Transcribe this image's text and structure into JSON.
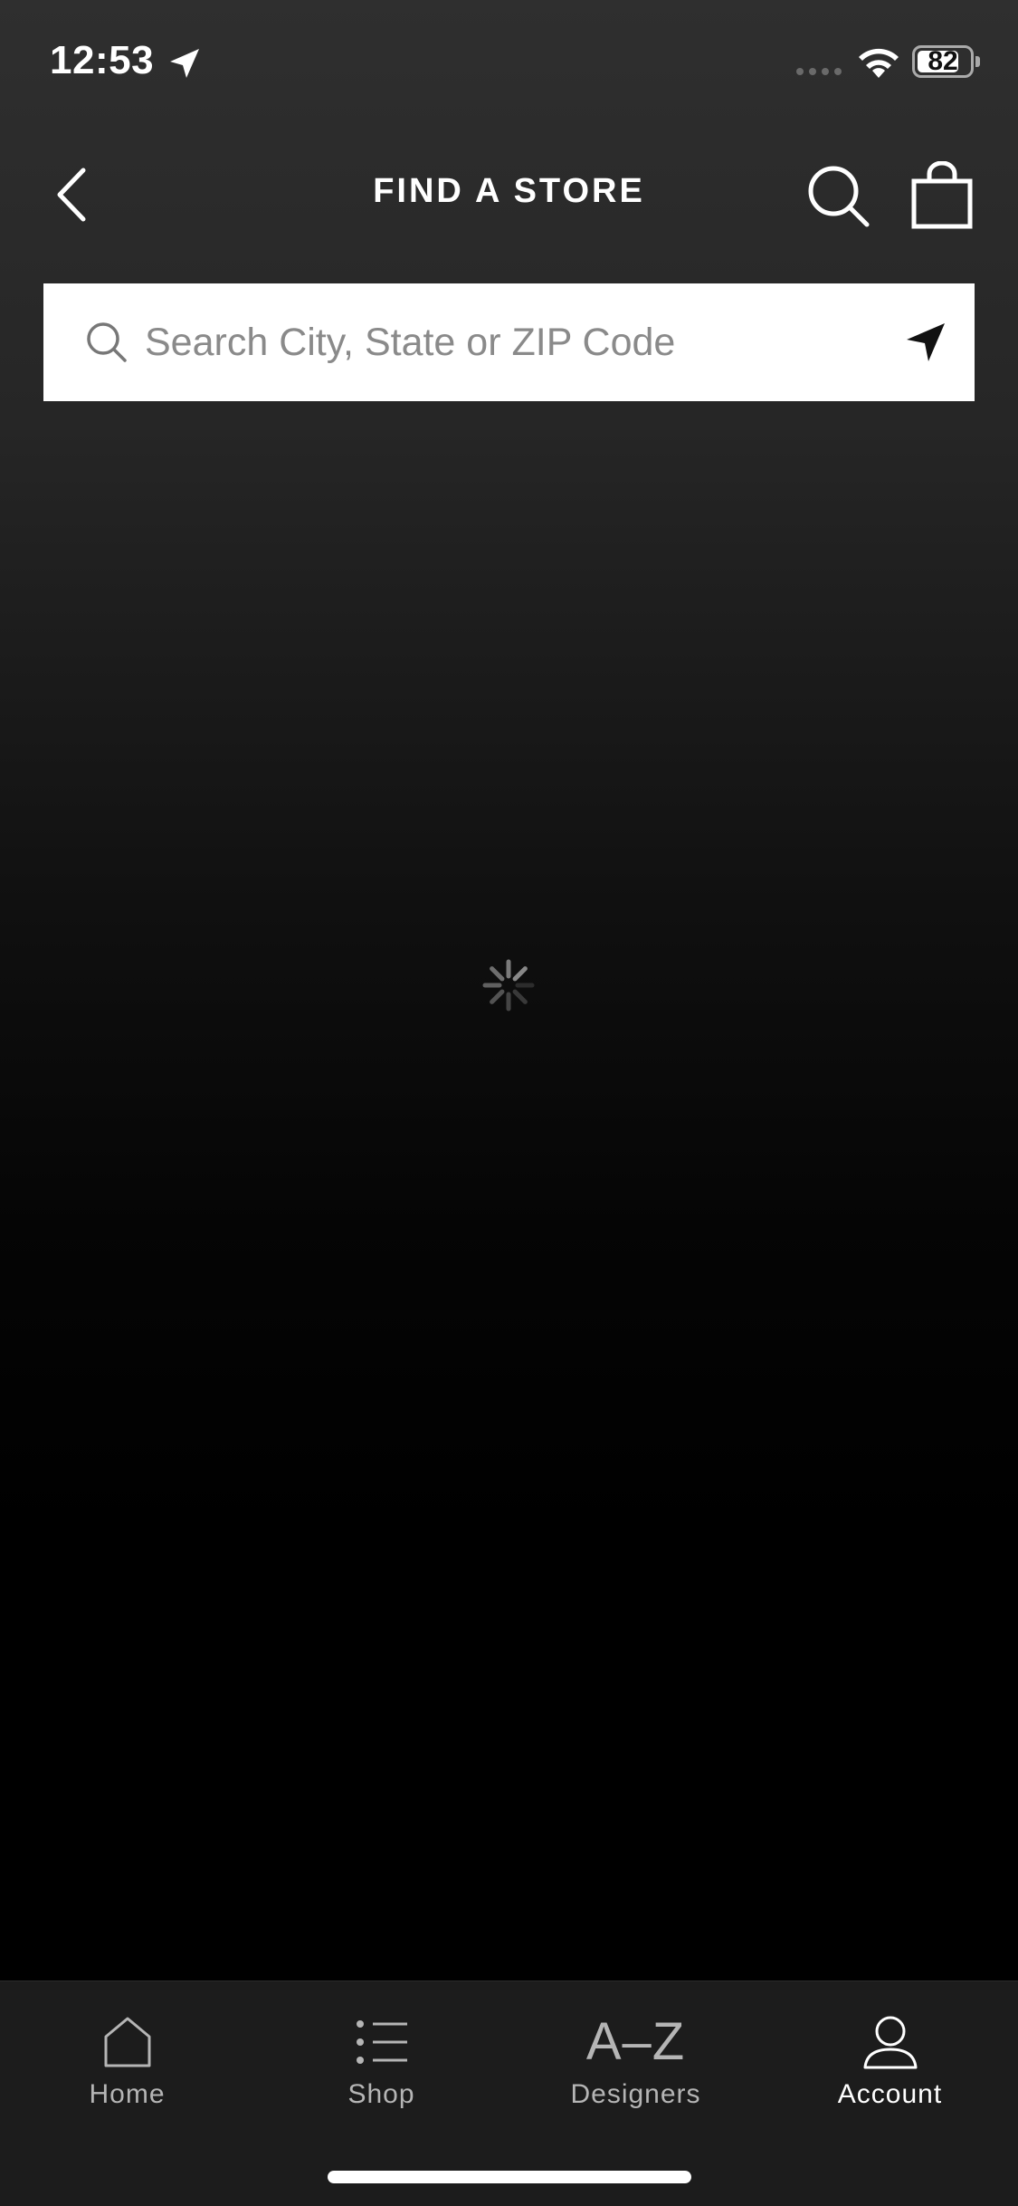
{
  "status_bar": {
    "time": "12:53",
    "battery_level": 82,
    "battery_text": "82",
    "icons": [
      "location-arrow-icon",
      "signal-icon",
      "wifi-icon",
      "battery-icon"
    ]
  },
  "header": {
    "title": "FIND A STORE",
    "icons": [
      "chevron-left-icon",
      "search-icon",
      "shopping-bag-icon"
    ]
  },
  "store_search": {
    "value": "",
    "placeholder": "Search City, State or ZIP Code",
    "icons": [
      "search-icon",
      "locate-arrow-icon"
    ]
  },
  "loading": {
    "icon": "spinner-icon"
  },
  "tab_bar": {
    "tabs": [
      {
        "label": "Home",
        "icon": "home-icon",
        "active": false
      },
      {
        "label": "Shop",
        "icon": "list-icon",
        "active": false
      },
      {
        "label": "Designers",
        "icon_text": "A–Z",
        "active": false
      },
      {
        "label": "Account",
        "icon": "person-icon",
        "active": true
      }
    ]
  },
  "colors": {
    "background_top": "#2f2f2f",
    "background_bottom": "#000000",
    "search_field": "#ffffff",
    "placeholder": "#8a8a8a",
    "tab_bar": "#1c1c1c",
    "tab_inactive": "#b5b5b5",
    "tab_active": "#ffffff"
  }
}
